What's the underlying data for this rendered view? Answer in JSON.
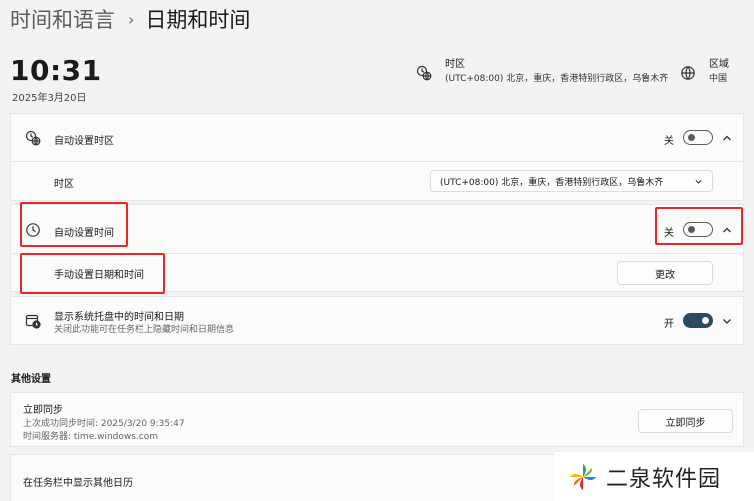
{
  "breadcrumb": {
    "parent": "时间和语言",
    "separator": "›",
    "current": "日期和时间"
  },
  "clock": {
    "time": "10:31",
    "date": "2025年3月20日"
  },
  "timezone_info": {
    "title": "时区",
    "value": "(UTC+08:00) 北京，重庆，香港特别行政区，乌鲁木齐",
    "icon": "clock-globe-icon"
  },
  "region_info": {
    "title": "区域",
    "value": "中国",
    "icon": "globe-icon"
  },
  "auto_timezone": {
    "label": "自动设置时区",
    "state_label": "关",
    "on": false,
    "icon": "clock-globe-icon"
  },
  "timezone_row": {
    "label": "时区",
    "selected": "(UTC+08:00) 北京，重庆，香港特别行政区，乌鲁木齐"
  },
  "auto_time": {
    "label": "自动设置时间",
    "state_label": "关",
    "on": false,
    "icon": "clock-icon"
  },
  "manual_datetime": {
    "label": "手动设置日期和时间",
    "button_label": "更改"
  },
  "tray": {
    "label": "显示系统托盘中的时间和日期",
    "sub": "关闭此功能可在任务栏上隐藏时间和日期信息",
    "state_label": "开",
    "on": true,
    "icon": "calendar-clock-icon"
  },
  "other_settings": {
    "title": "其他设置"
  },
  "sync": {
    "label": "立即同步",
    "last_sync": "上次成功同步时间: 2025/3/20 9:35:47",
    "server": "时间服务器: time.windows.com",
    "button_label": "立即同步"
  },
  "other_calendar": {
    "label": "在任务栏中显示其他日历"
  },
  "watermark": {
    "text": "二泉软件园"
  },
  "colors": {
    "highlight": "#e8262c",
    "toggle_on": "#2a4a62"
  }
}
